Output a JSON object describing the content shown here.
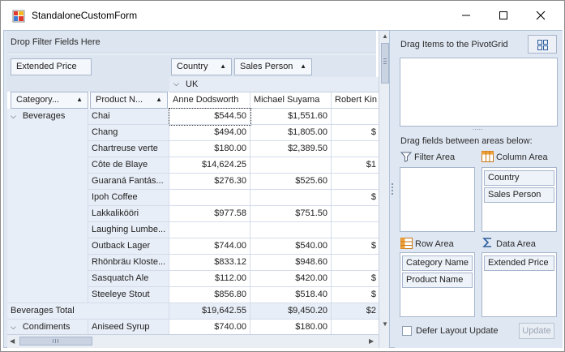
{
  "window": {
    "title": "StandaloneCustomForm",
    "minimize": "—",
    "maximize": "☐",
    "close": "✕"
  },
  "pivot": {
    "filter_area_text": "Drop Filter Fields Here",
    "data_field": "Extended Price",
    "column_fields": [
      "Country",
      "Sales Person"
    ],
    "row_fields": [
      "Category...",
      "Product N..."
    ],
    "country_value": "UK",
    "persons": [
      "Anne Dodsworth",
      "Michael Suyama",
      "Robert Kin"
    ],
    "category": "Beverages",
    "rows": [
      {
        "product": "Chai",
        "v": [
          "$544.50",
          "$1,551.60",
          ""
        ]
      },
      {
        "product": "Chang",
        "v": [
          "$494.00",
          "$1,805.00",
          "$"
        ]
      },
      {
        "product": "Chartreuse verte",
        "v": [
          "$180.00",
          "$2,389.50",
          ""
        ]
      },
      {
        "product": "Côte de Blaye",
        "v": [
          "$14,624.25",
          "",
          "$1"
        ]
      },
      {
        "product": "Guaraná Fantás...",
        "v": [
          "$276.30",
          "$525.60",
          ""
        ]
      },
      {
        "product": "Ipoh Coffee",
        "v": [
          "",
          "",
          "$"
        ]
      },
      {
        "product": "Lakkalikööri",
        "v": [
          "$977.58",
          "$751.50",
          ""
        ]
      },
      {
        "product": "Laughing Lumbe...",
        "v": [
          "",
          "",
          ""
        ]
      },
      {
        "product": "Outback Lager",
        "v": [
          "$744.00",
          "$540.00",
          "$"
        ]
      },
      {
        "product": "Rhönbräu Kloste...",
        "v": [
          "$833.12",
          "$948.60",
          ""
        ]
      },
      {
        "product": "Sasquatch Ale",
        "v": [
          "$112.00",
          "$420.00",
          "$"
        ]
      },
      {
        "product": "Steeleye Stout",
        "v": [
          "$856.80",
          "$518.40",
          "$"
        ]
      }
    ],
    "total_label": "Beverages Total",
    "total_values": [
      "$19,642.55",
      "$9,450.20",
      "$2"
    ],
    "next_category": "Condiments",
    "next_product": "Aniseed Syrup",
    "next_values": [
      "$740.00",
      "$180.00",
      ""
    ]
  },
  "form": {
    "drag_items_label": "Drag Items to the PivotGrid",
    "between_label": "Drag fields between areas below:",
    "filter_area_label": "Filter Area",
    "column_area_label": "Column Area",
    "row_area_label": "Row Area",
    "data_area_label": "Data Area",
    "column_items": [
      "Country",
      "Sales Person"
    ],
    "row_items": [
      "Category Name",
      "Product Name"
    ],
    "data_items": [
      "Extended Price"
    ],
    "defer_label": "Defer Layout Update",
    "update_label": "Update",
    "grip": "....."
  }
}
